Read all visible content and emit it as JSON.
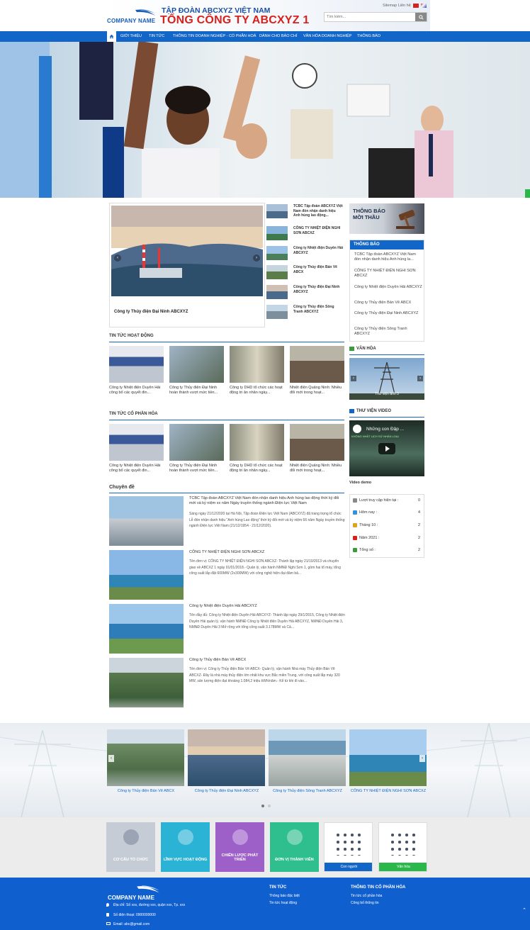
{
  "header": {
    "logo_text": "COMPANY NAME",
    "corp_line1": "TẬP ĐOÀN ABCXYZ VIỆT NAM",
    "corp_line2": "TỔNG CÔNG TY ABCXYZ 1",
    "top_links": "Sitemap  Liên hệ",
    "search_placeholder": "Tìm kiếm..."
  },
  "nav": {
    "home_icon": "home-icon",
    "items": [
      "GIỚI THIỆU",
      "TIN TỨC",
      "THÔNG TIN DOANH NGHIỆP - CỔ PHẦN HOÁ",
      "DÀNH CHO BÁO CHÍ",
      "VĂN HÓA DOANH NGHIỆP",
      "THÔNG BÁO"
    ]
  },
  "featured": {
    "caption": "Công ty Thủy điện Đại Ninh ABCXYZ",
    "news": [
      "TCBC Tập đoàn ABCXYZ Việt Nam đón nhận danh hiệu Anh hùng lao động...",
      "CÔNG TY NHIỆT ĐIỆN NGHI SƠN ABCXZ",
      "Công ty Nhiệt điện Duyên Hải ABCXYZ",
      "Công ty Thủy điện Bản Vẽ ABCX",
      "Công ty Thủy điện Đại Ninh ABCXYZ",
      "Công ty Thủy điện Sông Tranh ABCXYZ"
    ]
  },
  "sidebar": {
    "tender_label": "THÔNG BÁO MỜI THẦU",
    "notice_title": "THÔNG BÁO",
    "notices": [
      "TCBC Tập đoàn ABCXYZ Việt Nam đón nhận danh hiệu Anh hùng la...",
      "CÔNG TY NHIỆT ĐIỆN NGHI SƠN ABCXZ",
      "Công ty Nhiệt điện Duyên Hải ABCXYZ",
      "Công ty Thủy điện Bản Vẽ ABCX",
      "Công ty Thủy điện Đại Ninh ABCXYZ",
      "Công ty Thủy điện Sông Tranh ABCXYZ"
    ],
    "culture_title": "VĂN HÓA",
    "culture_caption": "Thư viện ảnh 3",
    "video_title": "THƯ VIỆN VIDEO",
    "video_overlay": "Những con Đập ...",
    "video_sub": "KHÔNG NHẤT LỊCH SỬ NHÂN LOẠI",
    "video_caption": "Video demo",
    "stats": [
      {
        "label": "Lượt truy cập hiện tại :",
        "value": "0"
      },
      {
        "label": "Hôm nay :",
        "value": "4"
      },
      {
        "label": "Tháng 10 :",
        "value": "2"
      },
      {
        "label": "Năm 2021 :",
        "value": "2"
      },
      {
        "label": "Tổng số :",
        "value": "2"
      }
    ]
  },
  "activity": {
    "title": "TIN TỨC HOẠT ĐỘNG",
    "items": [
      "Công ty Nhiệt điện Duyên Hải công bố các quyết đin...",
      "Công ty Thủy điện Đại Ninh hoàn thành vượt mức tiền...",
      "Công ty DHD tổ chức các hoạt động tri ân nhân ngày...",
      "Nhiệt điện Quảng Ninh: Nhiều đổi mới trong hoạt..."
    ]
  },
  "equitization": {
    "title": "TIN TỨC CỔ PHẦN HÓA",
    "items": [
      "Công ty Nhiệt điện Duyên Hải công bố các quyết đin...",
      "Công ty Thủy điện Đại Ninh hoàn thành vượt mức tiền...",
      "Công ty DHD tổ chức các hoạt động tri ân nhân ngày...",
      "Nhiệt điện Quảng Ninh: Nhiều đổi mới trong hoạt..."
    ]
  },
  "topics": {
    "title": "Chuyên đề",
    "items": [
      {
        "h": "TCBC Tập đoàn ABCXYZ Việt Nam đón nhận danh hiệu Anh hùng lao động thời kỳ đổi mới và kỷ niệm xx năm Ngày truyền thống ngành Điện lực Việt Nam",
        "d": "Sáng ngày 21/12/2020 tại Hà Nội, Tập đoàn Điện lực Việt Nam (ABCXYZ) đã trang trọng tổ chức Lễ đón nhận danh hiệu “Anh hùng Lao động” thời kỳ đổi mới và kỷ niệm 66 năm Ngày truyền thống ngành Điện lực Việt Nam (21/12/1954 - 21/12/2020)."
      },
      {
        "h": "CÔNG TY NHIỆT ĐIỆN NGHI SƠN ABCXZ",
        "d": "Tên đơn vị: CÔNG TY NHIỆT ĐIỆN NGHI SƠN ABCXZ- Thành lập ngày 21/10/2013 và chuyển giao về ABCXZ 1 ngày 01/01/2018.- Quản lý, vận hành NMNĐ Nghi Sơn 1, gồm hai tổ máy, tổng công suất lắp đặt 600MW (2x300MW) với công nghệ hiện đại đảm bả..."
      },
      {
        "h": "Công ty Nhiệt điện Duyên Hải ABCXYZ",
        "d": "Tên đầy đủ: Công ty Nhiệt điện Duyên Hải ABCXYZ- Thành lập ngày 29/1/2015, Công ty Nhiệt điện Duyên Hải quản lý, vận hành NMNĐ Công ty Nhiệt điện Duyên Hải ABCXYZ, NMNĐ Duyên Hải 3, NMNĐ Duyên Hải 3 Mở rộng với tổng công suất 3.178MW và Cả..."
      },
      {
        "h": "Công ty Thủy điện Bản Vẽ ABCX",
        "d": "Tên đơn vị: Công ty Thủy điện Bản Vẽ ABCX- Quản lý, vận hành Nhà máy Thủy điện Bản Vẽ ABCXZ- Đây là nhà máy thủy điện lớn nhất khu vực Bắc miền Trung, với công suất lắp máy 320 MW, sản lượng điện đạt khoảng 1.084,2 triệu kWh/năm.- Kể từ khi đi vào..."
      }
    ]
  },
  "projects": [
    "Công ty Thủy điện Bản Vẽ ABCX",
    "Công ty Thủy điện Đại Ninh ABCXYZ",
    "Công ty Thủy điện Sông Tranh ABCXYZ",
    "CÔNG TY NHIỆT ĐIỆN NGHI SƠN ABCXZ"
  ],
  "tiles": [
    "CƠ CẤU TỔ CHỨC",
    "LĨNH VỰC HOẠT ĐỘNG",
    "CHIẾN LƯỢC PHÁT TRIỂN",
    "ĐƠN VỊ THÀNH VIÊN",
    "Con người",
    "Văn hóa"
  ],
  "footer": {
    "logo_text": "COMPANY NAME",
    "address": "Địa chỉ: Số xxx, đường xxx, quận xxx, Tp. xxx",
    "phone": "Số điện thoại: 0900000000",
    "email": "Email: abc@gmail.com",
    "col1_title": "TIN TỨC",
    "col1_links": [
      "Thông báo đặc biệt",
      "Tin tức hoạt động"
    ],
    "col2_title": "THÔNG TIN CỔ PHẦN HÓA",
    "col2_links": [
      "Tin tức cổ phần hóa",
      "Công bố thông tin"
    ]
  },
  "colors": {
    "primary": "#1266c8",
    "brand_red": "#d8201c",
    "footer": "#0f5fcf"
  }
}
